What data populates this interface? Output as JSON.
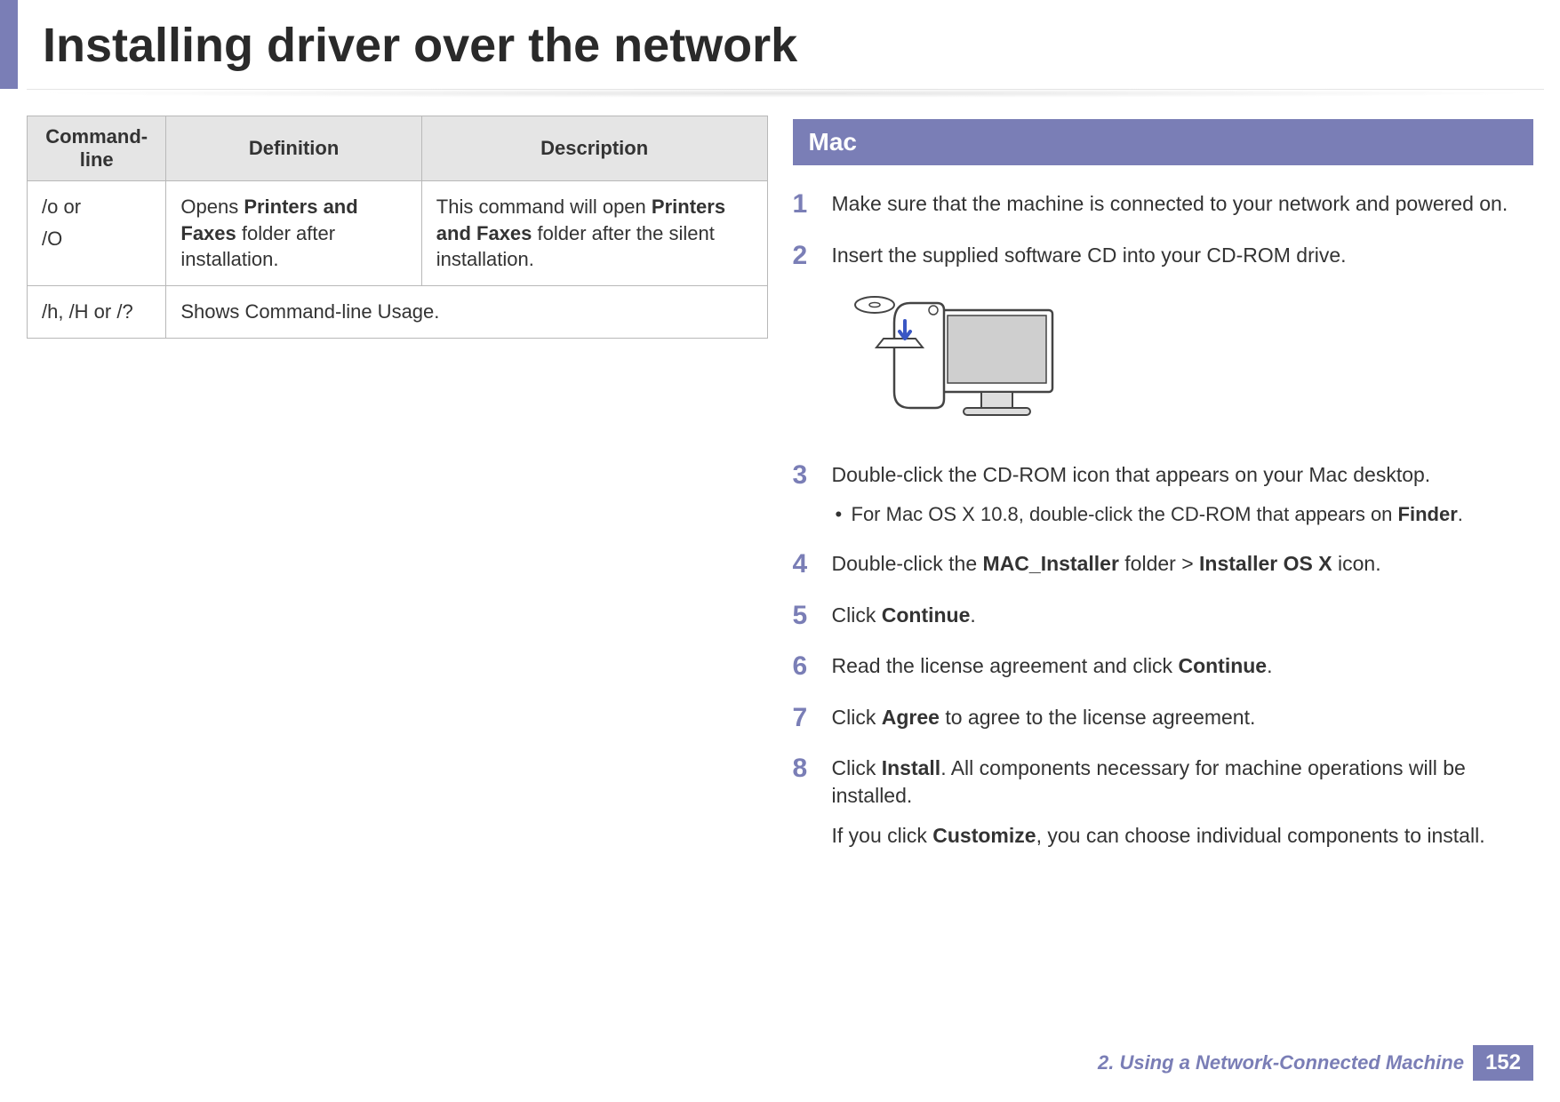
{
  "title": "Installing driver over the network",
  "table": {
    "headers": [
      "Command- line",
      "Definition",
      "Description"
    ],
    "rows": [
      {
        "cmd_line1": "/o or",
        "cmd_line2": "/O",
        "definition_pre": "Opens ",
        "definition_bold": "Printers and Faxes",
        "definition_post": " folder after installation.",
        "desc_pre": "This command will open ",
        "desc_bold": "Printers and Faxes",
        "desc_post": " folder after the silent installation."
      },
      {
        "cmd_line1": "/h, /H or /?",
        "definition_plain": "Shows Command-line Usage.",
        "desc_pre": "",
        "desc_bold": "",
        "desc_post": ""
      }
    ]
  },
  "section_title": "Mac",
  "steps": [
    {
      "num": "1",
      "pre": "Make sure that the machine is connected to your network and powered on."
    },
    {
      "num": "2",
      "pre": "Insert the supplied software CD into your CD-ROM drive.",
      "has_image": true
    },
    {
      "num": "3",
      "pre": "Double-click the CD-ROM icon that appears on your Mac desktop.",
      "sub_pre": "For Mac OS X 10.8, double-click the CD-ROM that appears on ",
      "sub_bold": "Finder",
      "sub_post": "."
    },
    {
      "num": "4",
      "pre": "Double-click the ",
      "bold1": "MAC_Installer",
      "mid": " folder > ",
      "bold2": "Installer OS X",
      "post": " icon."
    },
    {
      "num": "5",
      "pre": " Click ",
      "bold1": "Continue",
      "post": "."
    },
    {
      "num": "6",
      "pre": "Read the license agreement and click ",
      "bold1": "Continue",
      "post": "."
    },
    {
      "num": "7",
      "pre": "Click ",
      "bold1": "Agree",
      "post": " to agree to the license agreement."
    },
    {
      "num": "8",
      "pre": "Click ",
      "bold1": "Install",
      "post": ". All components necessary for machine operations will be installed.",
      "extra_pre": "If you click ",
      "extra_bold": "Customize",
      "extra_post": ", you can choose individual components to install."
    }
  ],
  "footer": {
    "chapter": "2.  Using a Network-Connected Machine",
    "page": "152"
  }
}
